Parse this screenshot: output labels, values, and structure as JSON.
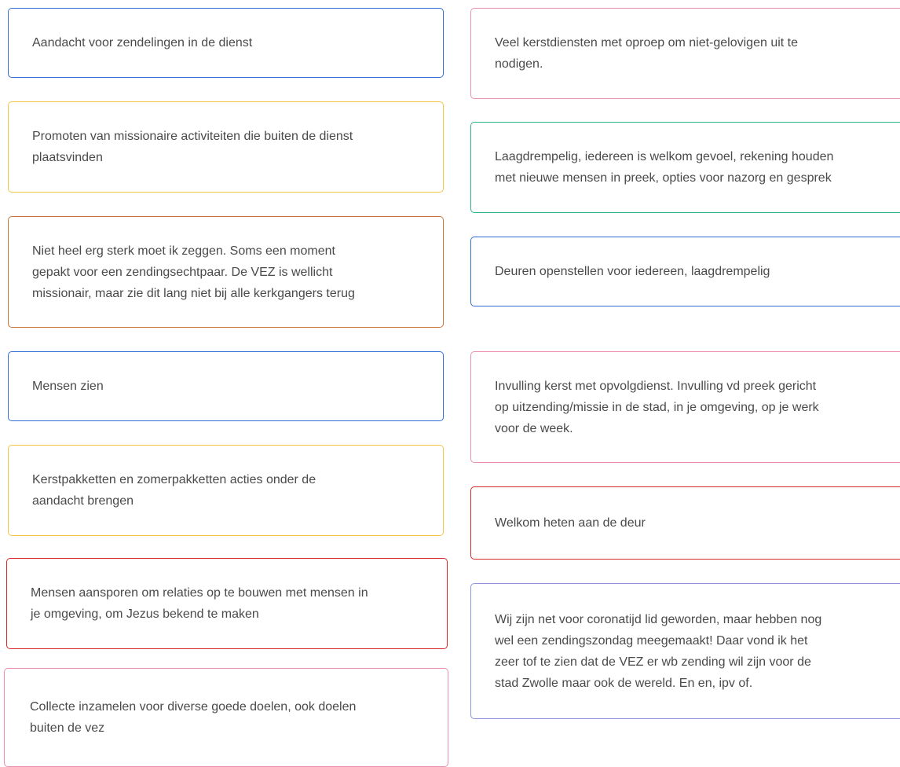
{
  "colors": {
    "blue": "#2f6fd6",
    "yellow": "#f4c542",
    "orange": "#c6733a",
    "red": "#d62828",
    "pink": "#ec8fae",
    "green": "#29b38a",
    "lavender": "#8f93e0"
  },
  "left_column": [
    {
      "text": "Aandacht voor zendelingen in de dienst",
      "color": "blue"
    },
    {
      "text": "Promoten van missionaire activiteiten die buiten de dienst\nplaatsvinden",
      "color": "yellow"
    },
    {
      "text": "Niet heel erg sterk moet ik zeggen. Soms een moment\ngepakt voor een zendingsechtpaar. De VEZ is wellicht\nmissionair, maar zie dit lang niet bij alle kerkgangers terug",
      "color": "orange"
    },
    {
      "text": "Mensen zien",
      "color": "blue"
    },
    {
      "text": "Kerstpakketten en zomerpakketten acties onder de\naandacht brengen",
      "color": "yellow"
    },
    {
      "text": "Mensen aansporen om relaties op te bouwen met mensen in\nje omgeving, om Jezus bekend te maken",
      "color": "red"
    },
    {
      "text": "Collecte inzamelen voor diverse goede doelen, ook doelen\nbuiten de vez",
      "color": "pink"
    }
  ],
  "right_column": [
    {
      "text": "Veel kerstdiensten met oproep om niet-gelovigen uit te\nnodigen.",
      "color": "pink"
    },
    {
      "text": "Laagdrempelig, iedereen is welkom gevoel, rekening houden\nmet nieuwe mensen in preek, opties voor nazorg en gesprek",
      "color": "green"
    },
    {
      "text": "Deuren openstellen voor iedereen, laagdrempelig",
      "color": "blue"
    },
    {
      "text": "Invulling kerst met opvolgdienst. Invulling vd preek gericht\nop uitzending/missie in de stad, in je omgeving, op je werk\nvoor de week.",
      "color": "pink"
    },
    {
      "text": "Welkom heten aan de deur",
      "color": "red"
    },
    {
      "text": "Wij zijn net voor coronatijd lid geworden, maar hebben nog\nwel een zendingszondag meegemaakt! Daar vond ik het\nzeer tof te zien dat de VEZ er wb zending wil zijn voor de\nstad Zwolle maar ook de wereld. En en, ipv of.",
      "color": "lavender"
    }
  ]
}
